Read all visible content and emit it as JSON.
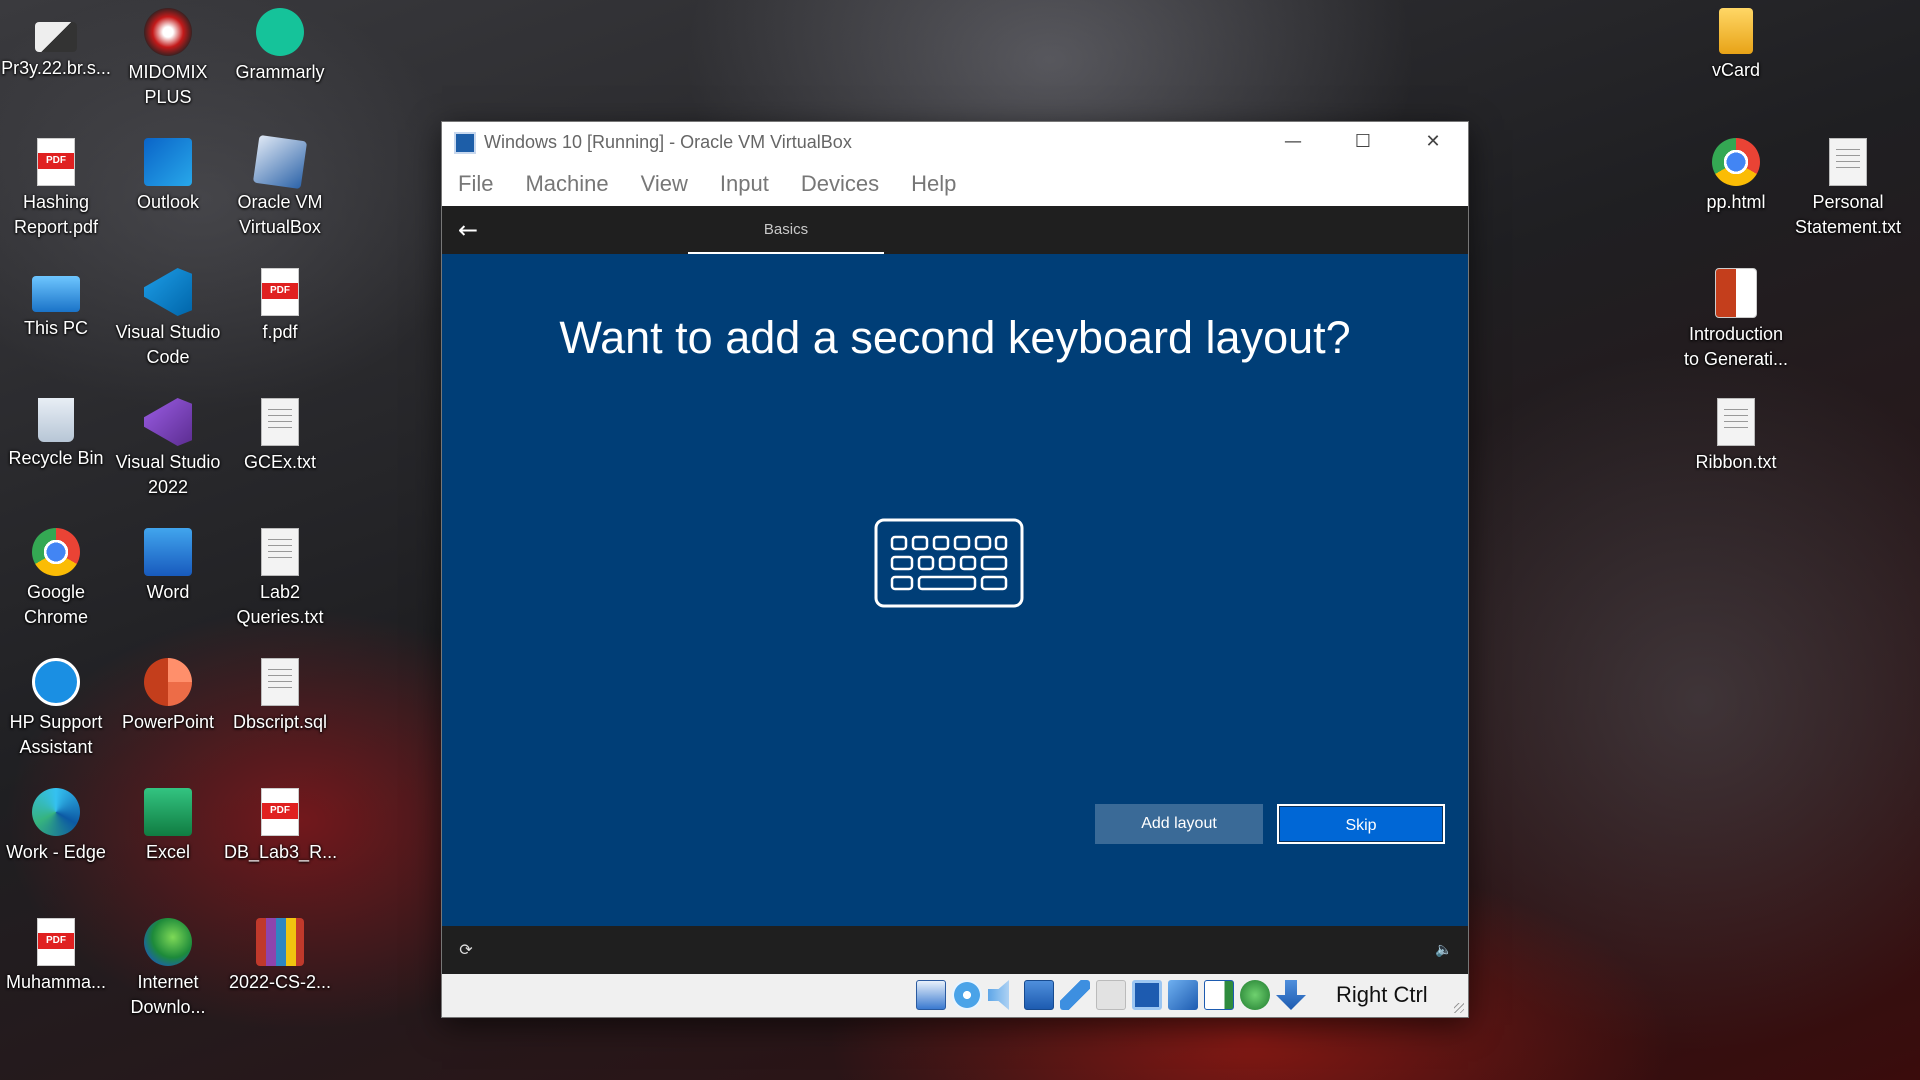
{
  "desktop": {
    "icons": [
      {
        "label": "Pr3y.22.br.s...",
        "icon": "file-icon"
      },
      {
        "label": "MIDOMIX PLUS",
        "icon": "midomix-icon"
      },
      {
        "label": "Grammarly",
        "icon": "grammarly-icon"
      },
      {
        "label": "Hashing Report.pdf",
        "icon": "pdf-icon"
      },
      {
        "label": "Outlook",
        "icon": "outlook-icon"
      },
      {
        "label": "Oracle VM VirtualBox",
        "icon": "virtualbox-icon"
      },
      {
        "label": "This PC",
        "icon": "this-pc-icon"
      },
      {
        "label": "Visual Studio Code",
        "icon": "vscode-icon"
      },
      {
        "label": "f.pdf",
        "icon": "pdf-icon"
      },
      {
        "label": "Recycle Bin",
        "icon": "recycle-bin-icon"
      },
      {
        "label": "Visual Studio 2022",
        "icon": "visual-studio-icon"
      },
      {
        "label": "GCEx.txt",
        "icon": "text-file-icon"
      },
      {
        "label": "Google Chrome",
        "icon": "chrome-icon"
      },
      {
        "label": "Word",
        "icon": "word-icon"
      },
      {
        "label": "Lab2 Queries.txt",
        "icon": "text-file-icon"
      },
      {
        "label": "HP Support Assistant",
        "icon": "hp-support-icon"
      },
      {
        "label": "PowerPoint",
        "icon": "powerpoint-icon"
      },
      {
        "label": "Dbscript.sql",
        "icon": "sql-file-icon"
      },
      {
        "label": "Work - Edge",
        "icon": "edge-icon"
      },
      {
        "label": "Excel",
        "icon": "excel-icon"
      },
      {
        "label": "DB_Lab3_R...",
        "icon": "pdf-icon"
      },
      {
        "label": "Muhamma...",
        "icon": "pdf-icon"
      },
      {
        "label": "Internet Downlo...",
        "icon": "idm-icon"
      },
      {
        "label": "2022-CS-2...",
        "icon": "winrar-icon"
      },
      {
        "label": "vCard",
        "icon": "folder-icon"
      },
      {
        "label": "pp.html",
        "icon": "chrome-icon"
      },
      {
        "label": "Personal Statement.txt",
        "icon": "text-file-icon"
      },
      {
        "label": "Introduction to Generati...",
        "icon": "powerpoint-file-icon"
      },
      {
        "label": "Ribbon.txt",
        "icon": "text-file-icon"
      }
    ]
  },
  "window": {
    "title": "Windows 10 [Running] - Oracle VM VirtualBox",
    "controls": {
      "minimize": "—",
      "maximize": "☐",
      "close": "✕"
    },
    "menu": [
      "File",
      "Machine",
      "View",
      "Input",
      "Devices",
      "Help"
    ]
  },
  "guest": {
    "tab": "Basics",
    "headline": "Want to add a second keyboard layout?",
    "buttons": {
      "add_layout": "Add layout",
      "skip": "Skip"
    }
  },
  "statusbar": {
    "host_key": "Right Ctrl",
    "icons": [
      "hard-disk-icon",
      "optical-drive-icon",
      "audio-icon",
      "network-icon",
      "usb-icon",
      "shared-folders-icon",
      "display-icon",
      "video-capture-icon",
      "recording-icon",
      "cpu-icon",
      "mouse-integration-icon"
    ]
  },
  "colors": {
    "guest_background": "#003e77",
    "skip_button": "#0067d6",
    "add_layout_button": "#3a6a97"
  }
}
